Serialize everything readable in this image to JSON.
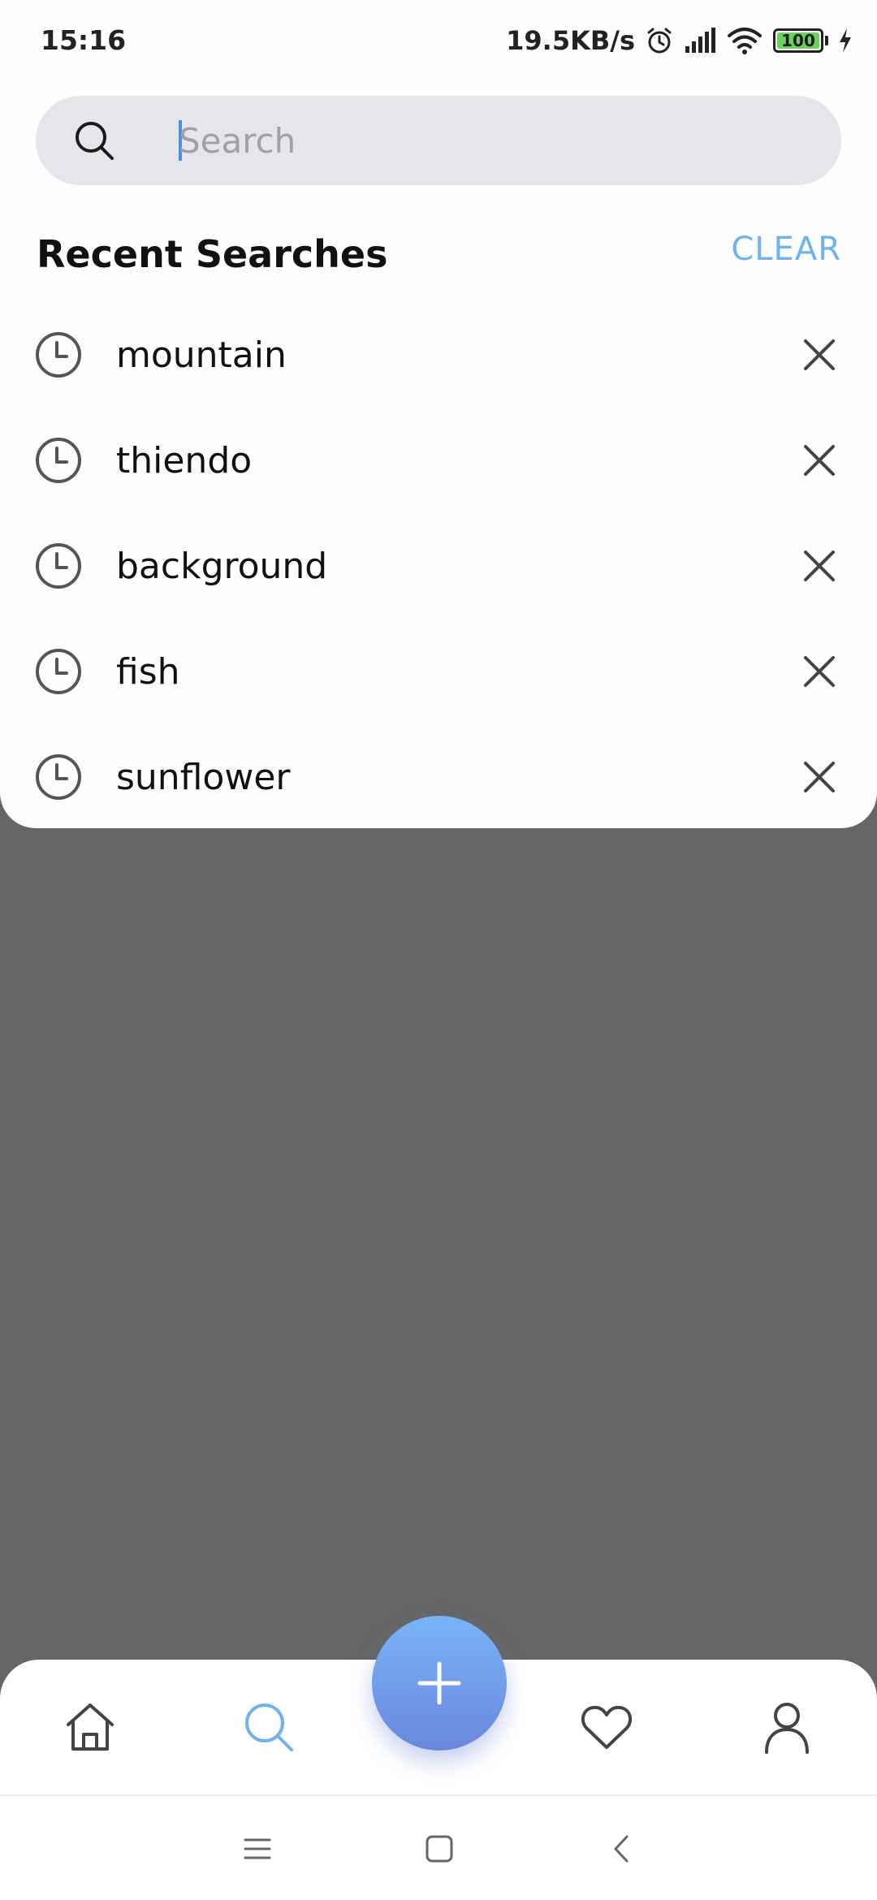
{
  "status_bar": {
    "time": "15:16",
    "net_speed": "19.5KB/s",
    "battery_level": "100",
    "icons": [
      "alarm-icon",
      "signal-icon",
      "wifi-icon",
      "battery-icon",
      "charging-icon"
    ]
  },
  "search": {
    "placeholder": "Search",
    "value": ""
  },
  "recent": {
    "title": "Recent Searches",
    "clear_label": "CLEAR",
    "items": [
      {
        "label": "mountain"
      },
      {
        "label": "thiendo"
      },
      {
        "label": "background"
      },
      {
        "label": "fish"
      },
      {
        "label": "sunflower"
      }
    ]
  },
  "bottom_nav": {
    "items": [
      "home-icon",
      "search-icon",
      "add-icon",
      "heart-icon",
      "profile-icon"
    ],
    "active": "search-icon"
  },
  "colors": {
    "accent": "#6fb2ee",
    "fab_top": "#79b4f7",
    "fab_bottom": "#6a87dc",
    "backdrop": "#666666",
    "search_bg": "#e5e6ea"
  }
}
